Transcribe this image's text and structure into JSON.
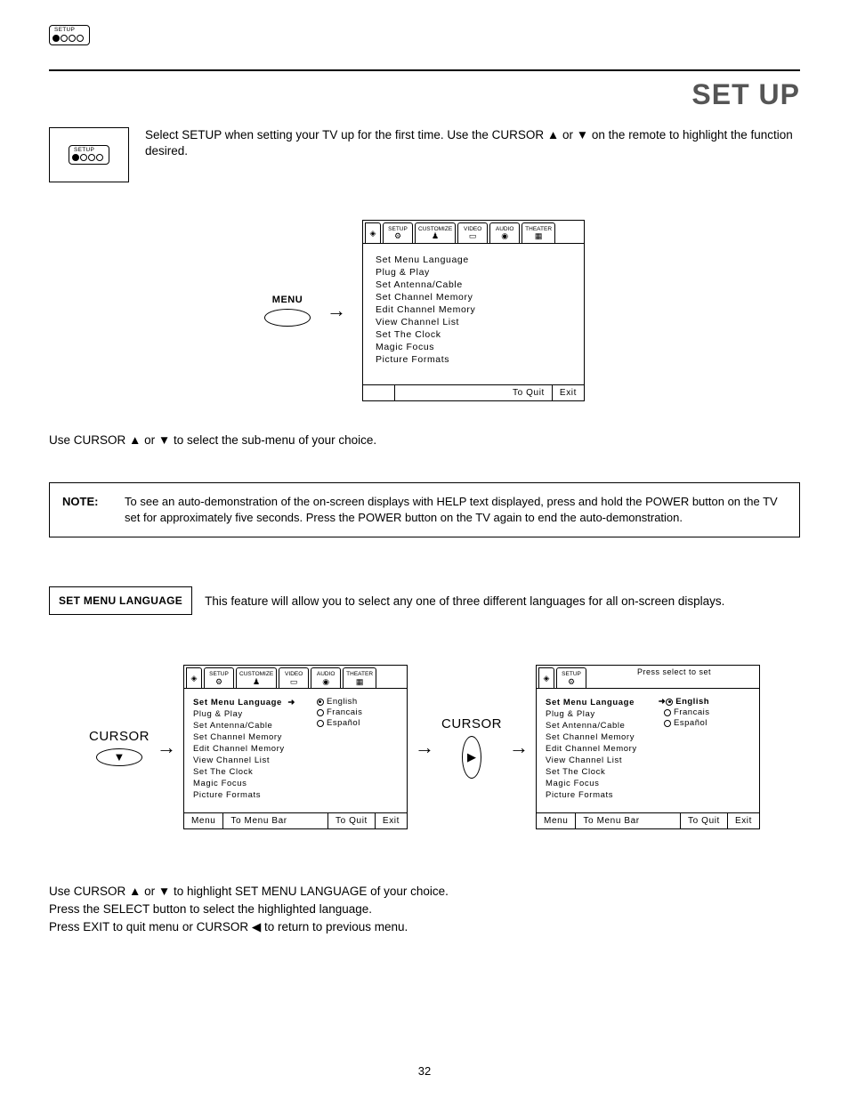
{
  "page": {
    "title": "SET UP",
    "number": "32"
  },
  "icon": {
    "label": "SETUP"
  },
  "intro": {
    "text": "Select SETUP when setting your TV up for the first time.  Use the CURSOR ▲ or ▼ on the remote to highlight the function desired."
  },
  "tabs": {
    "setup": "SETUP",
    "customize": "CUSTOMIZE",
    "video": "VIDEO",
    "audio": "AUDIO",
    "theater": "THEATER"
  },
  "osd_menu": {
    "label": "MENU",
    "items": [
      "Set Menu Language",
      "Plug & Play",
      "Set Antenna/Cable",
      "Set Channel Memory",
      "Edit Channel Memory",
      "View Channel List",
      "Set The Clock",
      "Magic Focus",
      "Picture Formats"
    ],
    "to_quit": "To Quit",
    "exit": "Exit",
    "menu": "Menu",
    "menubar": "To Menu Bar"
  },
  "sub_instruction": "Use CURSOR ▲ or ▼ to select the sub-menu of your choice.",
  "note": {
    "label": "NOTE:",
    "text": "To see an auto-demonstration of the on-screen displays with HELP text displayed, press and hold the POWER button on the TV set for approximately five seconds. Press the POWER button on the TV again to end the auto-demonstration."
  },
  "section": {
    "label": "SET MENU LANGUAGE",
    "text": "This feature will allow you to select any one of three different languages for all on-screen displays."
  },
  "cursor_label": "CURSOR",
  "help_text": "Press select to set",
  "languages": {
    "english": "English",
    "francais": "Francais",
    "espanol": "Español"
  },
  "final": {
    "l1": "Use CURSOR ▲ or ▼ to highlight SET MENU LANGUAGE of your choice.",
    "l2": "Press the SELECT button to select the highlighted language.",
    "l3": "Press EXIT to quit menu or CURSOR ◀ to return to previous menu."
  }
}
